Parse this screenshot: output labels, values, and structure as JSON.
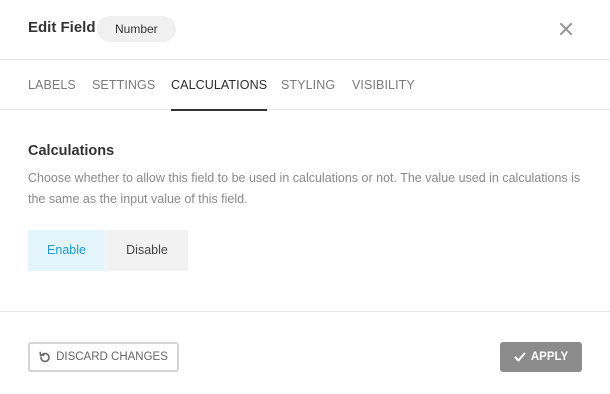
{
  "header": {
    "title": "Edit Field",
    "badge": "Number",
    "close_icon": "close-icon"
  },
  "tabs": [
    {
      "label": "LABELS",
      "active": false
    },
    {
      "label": "SETTINGS",
      "active": false
    },
    {
      "label": "CALCULATIONS",
      "active": true
    },
    {
      "label": "STYLING",
      "active": false
    },
    {
      "label": "VISIBILITY",
      "active": false
    }
  ],
  "section": {
    "title": "Calculations",
    "description": "Choose whether to allow this field to be used in calculations or not. The value used in calculations is the same as the input value of this field."
  },
  "toggle": {
    "options": [
      "Enable",
      "Disable"
    ],
    "selected": "Enable"
  },
  "footer": {
    "discard_label": "DISCARD CHANGES",
    "discard_icon": "undo-icon",
    "apply_label": "APPLY",
    "apply_icon": "check-icon"
  },
  "colors": {
    "accent": "#1a9ad6",
    "accent_bg": "#e3f4fc",
    "apply_bg": "#8c8c8c"
  }
}
